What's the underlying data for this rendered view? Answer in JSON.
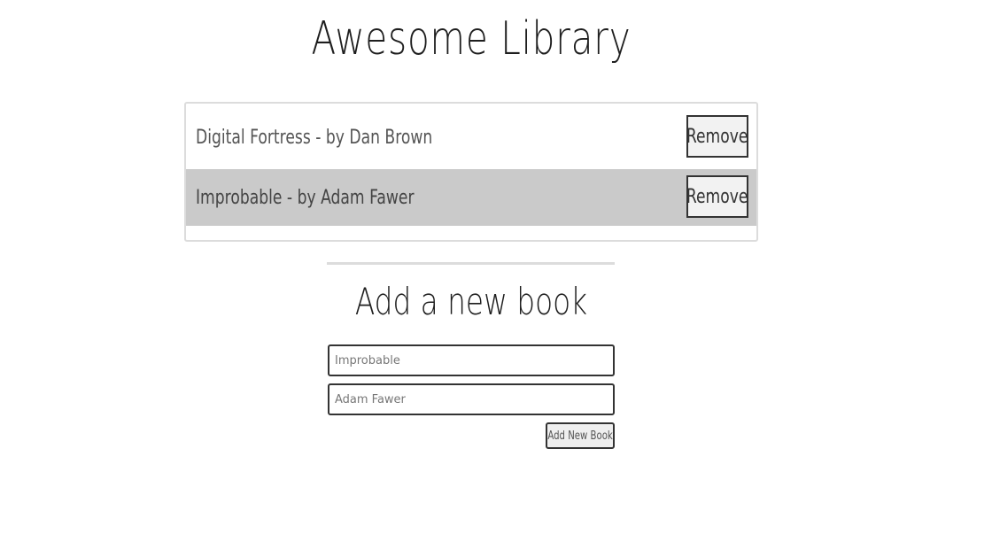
{
  "page": {
    "title": "Awesome Library"
  },
  "books": [
    {
      "text": "Digital Fortress - by Dan Brown",
      "remove_label": "Remove"
    },
    {
      "text": "Improbable - by Adam Fawer",
      "remove_label": "Remove"
    }
  ],
  "form": {
    "heading": "Add a new book",
    "title_placeholder": "Improbable",
    "author_placeholder": "Adam Fawer",
    "submit_label": "Add New Book"
  },
  "colors": {
    "row_highlight": "#cacaca",
    "border": "#dcdcdc"
  }
}
